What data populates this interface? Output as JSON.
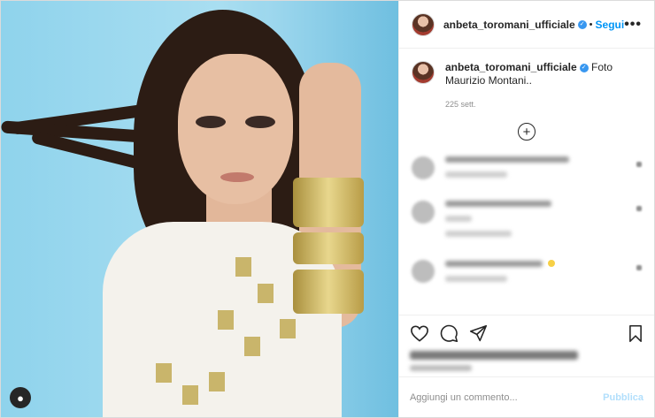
{
  "header": {
    "username": "anbeta_toromani_ufficiale",
    "separator": "•",
    "follow_label": "Segui",
    "more_label": "•••"
  },
  "caption": {
    "username": "anbeta_toromani_ufficiale",
    "text": "Foto Maurizio Montani..",
    "time": "225 sett."
  },
  "load_more_label": "+",
  "comments": [
    {
      "blurred": true
    },
    {
      "blurred": true
    },
    {
      "blurred": true
    }
  ],
  "actions": {
    "icons": [
      "heart-icon",
      "comment-icon",
      "share-icon",
      "bookmark-icon"
    ]
  },
  "add_comment": {
    "placeholder": "Aggiungi un commento...",
    "publish_label": "Pubblica"
  },
  "colors": {
    "accent": "#0095f6",
    "publish_disabled": "#b2dffc",
    "verified": "#3897f0",
    "photo_background": "#8fd3ec"
  }
}
